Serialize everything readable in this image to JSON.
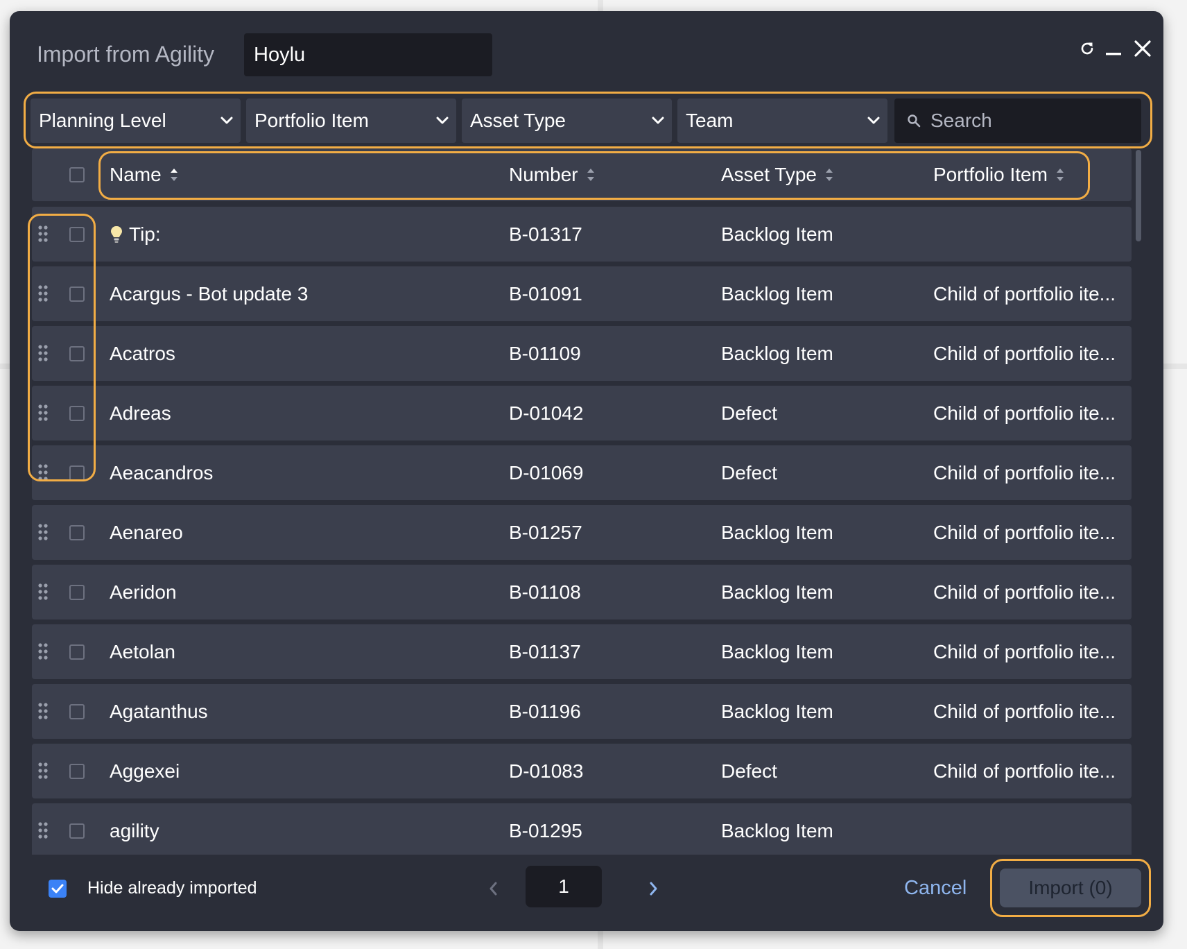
{
  "dialog": {
    "title": "Import from Agility",
    "board_name": "Hoylu",
    "controls": [
      "refresh-icon",
      "minimize-icon",
      "close-icon"
    ]
  },
  "filters": {
    "planning_level": "Planning Level",
    "portfolio_item": "Portfolio Item",
    "asset_type": "Asset Type",
    "team": "Team",
    "search_placeholder": "Search"
  },
  "table": {
    "columns": {
      "name": "Name",
      "number": "Number",
      "asset_type": "Asset Type",
      "portfolio_item": "Portfolio Item"
    },
    "rows": [
      {
        "name": "Tip:",
        "number": "B-01317",
        "asset_type": "Backlog Item",
        "portfolio": "",
        "icon": "lightbulb-icon"
      },
      {
        "name": "Acargus - Bot update 3",
        "number": "B-01091",
        "asset_type": "Backlog Item",
        "portfolio": "Child of portfolio ite..."
      },
      {
        "name": "Acatros",
        "number": "B-01109",
        "asset_type": "Backlog Item",
        "portfolio": "Child of portfolio ite..."
      },
      {
        "name": "Adreas",
        "number": "D-01042",
        "asset_type": "Defect",
        "portfolio": "Child of portfolio ite..."
      },
      {
        "name": "Aeacandros",
        "number": "D-01069",
        "asset_type": "Defect",
        "portfolio": "Child of portfolio ite..."
      },
      {
        "name": "Aenareo",
        "number": "B-01257",
        "asset_type": "Backlog Item",
        "portfolio": "Child of portfolio ite..."
      },
      {
        "name": "Aeridon",
        "number": "B-01108",
        "asset_type": "Backlog Item",
        "portfolio": "Child of portfolio ite..."
      },
      {
        "name": "Aetolan",
        "number": "B-01137",
        "asset_type": "Backlog Item",
        "portfolio": "Child of portfolio ite..."
      },
      {
        "name": "Agatanthus",
        "number": "B-01196",
        "asset_type": "Backlog Item",
        "portfolio": "Child of portfolio ite..."
      },
      {
        "name": "Aggexei",
        "number": "D-01083",
        "asset_type": "Defect",
        "portfolio": "Child of portfolio ite..."
      },
      {
        "name": "agility",
        "number": "B-01295",
        "asset_type": "Backlog Item",
        "portfolio": ""
      }
    ]
  },
  "footer": {
    "hide_imported_label": "Hide already imported",
    "hide_imported_checked": true,
    "page": "1",
    "cancel_label": "Cancel",
    "import_label": "Import (0)"
  },
  "colors": {
    "dialog_bg": "#2b2e39",
    "row_bg": "#3b3f4d",
    "input_bg": "#1b1c23",
    "highlight": "#f2ad45",
    "accent_blue": "#3b82f6",
    "cancel_text": "#8fb6ef"
  }
}
